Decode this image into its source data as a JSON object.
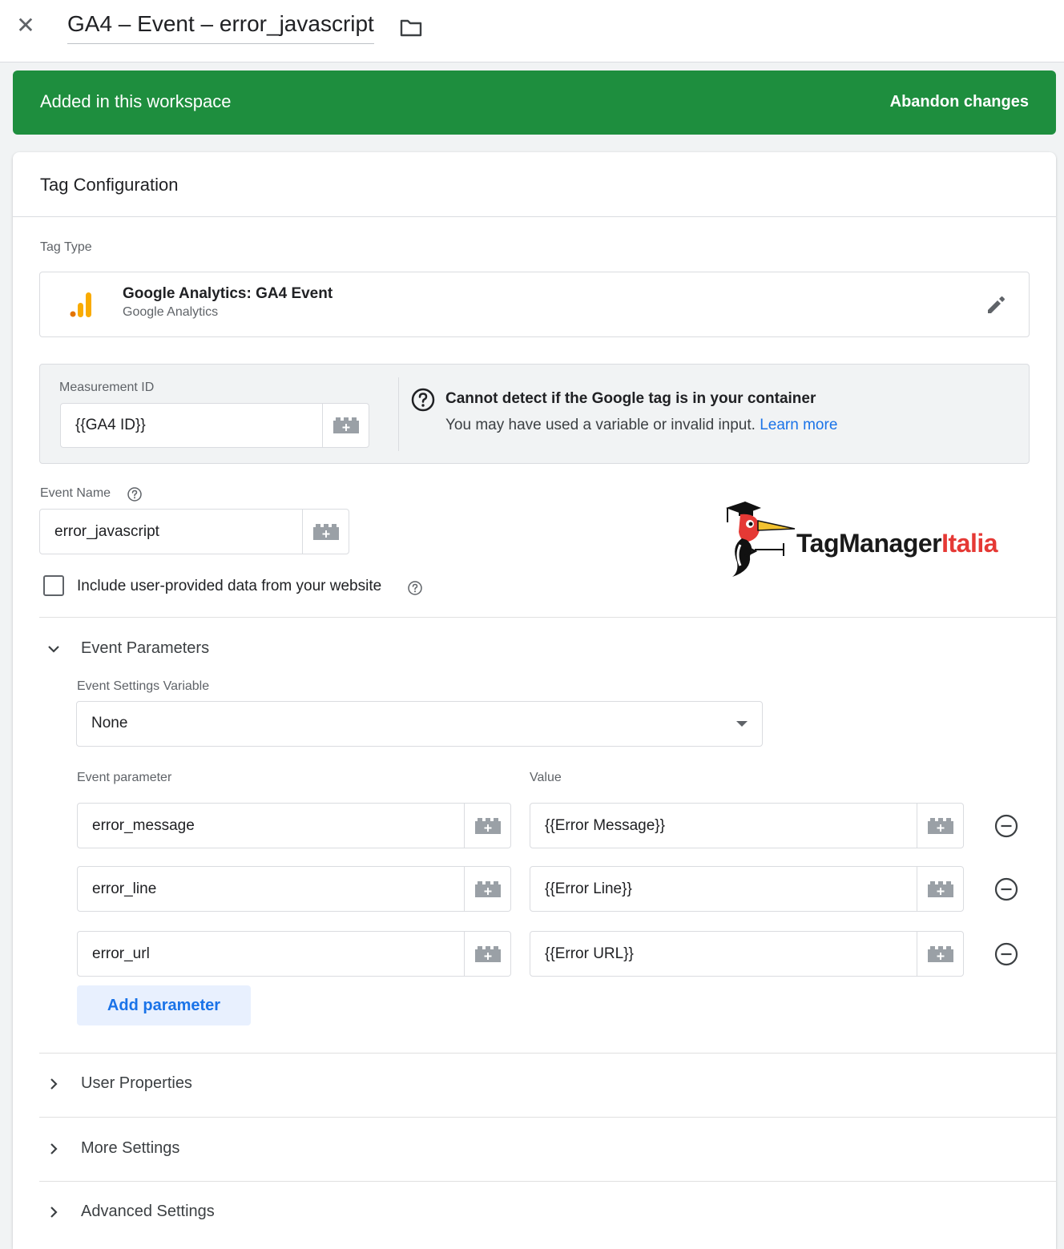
{
  "header": {
    "tag_name": "GA4 – Event – error_javascript"
  },
  "banner": {
    "status_text": "Added in this workspace",
    "abandon_label": "Abandon changes",
    "color": "#1e8e3e"
  },
  "card": {
    "title": "Tag Configuration"
  },
  "tag_type": {
    "section_label": "Tag Type",
    "name": "Google Analytics: GA4 Event",
    "provider": "Google Analytics"
  },
  "measurement": {
    "label": "Measurement ID",
    "value": "{{GA4 ID}}",
    "warning_title": "Cannot detect if the Google tag is in your container",
    "warning_text": "You may have used a variable or invalid input.",
    "learn_more": "Learn more"
  },
  "event_name": {
    "label": "Event Name",
    "value": "error_javascript"
  },
  "user_data": {
    "label": "Include user-provided data from your website",
    "checked": false
  },
  "logo": {
    "text_dark": "TagManager",
    "text_red": "Italia"
  },
  "event_parameters": {
    "section_label": "Event Parameters",
    "settings_variable_label": "Event Settings Variable",
    "settings_variable_value": "None",
    "param_col_header": "Event parameter",
    "value_col_header": "Value",
    "rows": [
      {
        "param": "error_message",
        "value": "{{Error Message}}"
      },
      {
        "param": "error_line",
        "value": "{{Error Line}}"
      },
      {
        "param": "error_url",
        "value": "{{Error URL}}"
      }
    ],
    "add_label": "Add parameter"
  },
  "sections": {
    "user_properties": "User Properties",
    "more_settings": "More Settings",
    "advanced_settings": "Advanced Settings"
  },
  "colors": {
    "accent": "#1a73e8",
    "ga_orange": "#f9ab00",
    "ga_dark_orange": "#e37400"
  }
}
